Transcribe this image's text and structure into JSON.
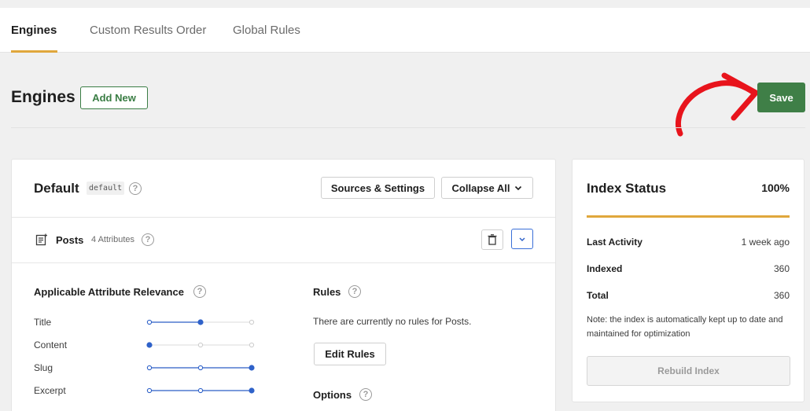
{
  "tabs": [
    {
      "label": "Engines",
      "active": true
    },
    {
      "label": "Custom Results Order",
      "active": false
    },
    {
      "label": "Global Rules",
      "active": false
    }
  ],
  "header": {
    "title": "Engines",
    "add_new_label": "Add New",
    "save_label": "Save"
  },
  "engine": {
    "name": "Default",
    "slug": "default",
    "sources_settings_label": "Sources & Settings",
    "collapse_all_label": "Collapse All",
    "source": {
      "label": "Posts",
      "attributes_count": "4 Attributes"
    },
    "relevance": {
      "title": "Applicable Attribute Relevance",
      "attributes": [
        {
          "label": "Title",
          "level": 0.5
        },
        {
          "label": "Content",
          "level": 0.0
        },
        {
          "label": "Slug",
          "level": 1.0
        },
        {
          "label": "Excerpt",
          "level": 1.0
        }
      ]
    },
    "rules": {
      "title": "Rules",
      "empty_text": "There are currently no rules for Posts.",
      "edit_rules_label": "Edit Rules"
    },
    "options": {
      "title": "Options"
    }
  },
  "index_status": {
    "title": "Index Status",
    "percent_label": "100%",
    "progress": 1.0,
    "rows": [
      {
        "label": "Last Activity",
        "value": "1 week ago"
      },
      {
        "label": "Indexed",
        "value": "360"
      },
      {
        "label": "Total",
        "value": "360"
      }
    ],
    "note": "Note: the index is automatically kept up to date and maintained for optimization",
    "rebuild_label": "Rebuild Index"
  },
  "colors": {
    "accent_orange": "#e0a73c",
    "brand_green": "#3f7f47",
    "slider_blue": "#2f62c9",
    "annotation_red": "#e8141c"
  }
}
